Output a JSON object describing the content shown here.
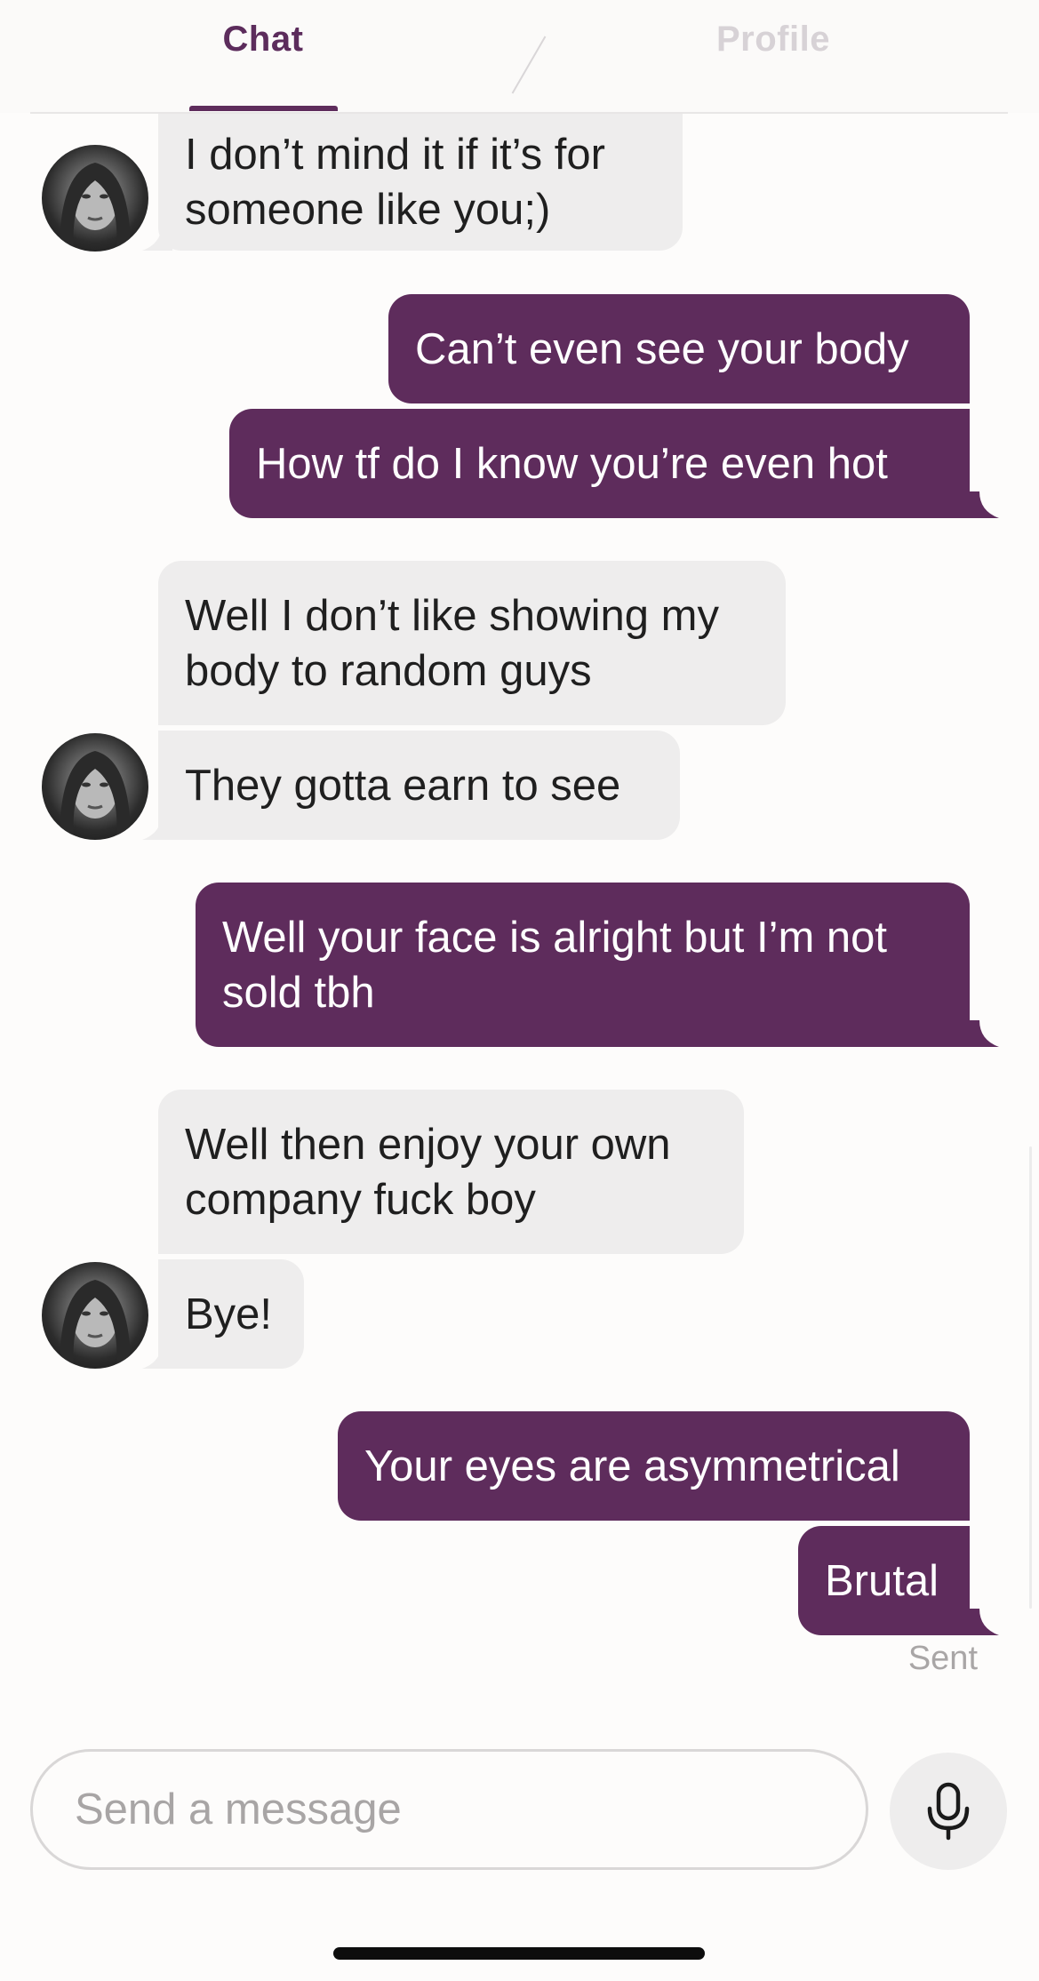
{
  "tabs": {
    "chat_label": "Chat",
    "profile_label": "Profile"
  },
  "messages": [
    {
      "sender": "them",
      "text": "I don’t mind it if it’s for\nsomeone like you;)"
    },
    {
      "sender": "me",
      "text": "Can’t even see your body"
    },
    {
      "sender": "me",
      "text": "How tf do I know you’re even hot"
    },
    {
      "sender": "them",
      "text": "Well I don’t like showing my\nbody to random guys"
    },
    {
      "sender": "them",
      "text": "They gotta earn to see"
    },
    {
      "sender": "me",
      "text": "Well your face is alright but I’m not\nsold tbh"
    },
    {
      "sender": "them",
      "text": "Well then enjoy your own\ncompany fuck boy"
    },
    {
      "sender": "them",
      "text": "Bye!"
    },
    {
      "sender": "me",
      "text": "Your eyes are asymmetrical"
    },
    {
      "sender": "me",
      "text": "Brutal"
    }
  ],
  "status": {
    "sent_label": "Sent"
  },
  "composer": {
    "placeholder": "Send a message"
  },
  "icons": {
    "mic": "microphone-icon",
    "avatar": "avatar"
  },
  "colors": {
    "accent": "#5e2c5c",
    "incoming_bubble": "#eeeded",
    "outgoing_bubble": "#5e2c5c",
    "inactive_tab": "#d7d2d6"
  }
}
